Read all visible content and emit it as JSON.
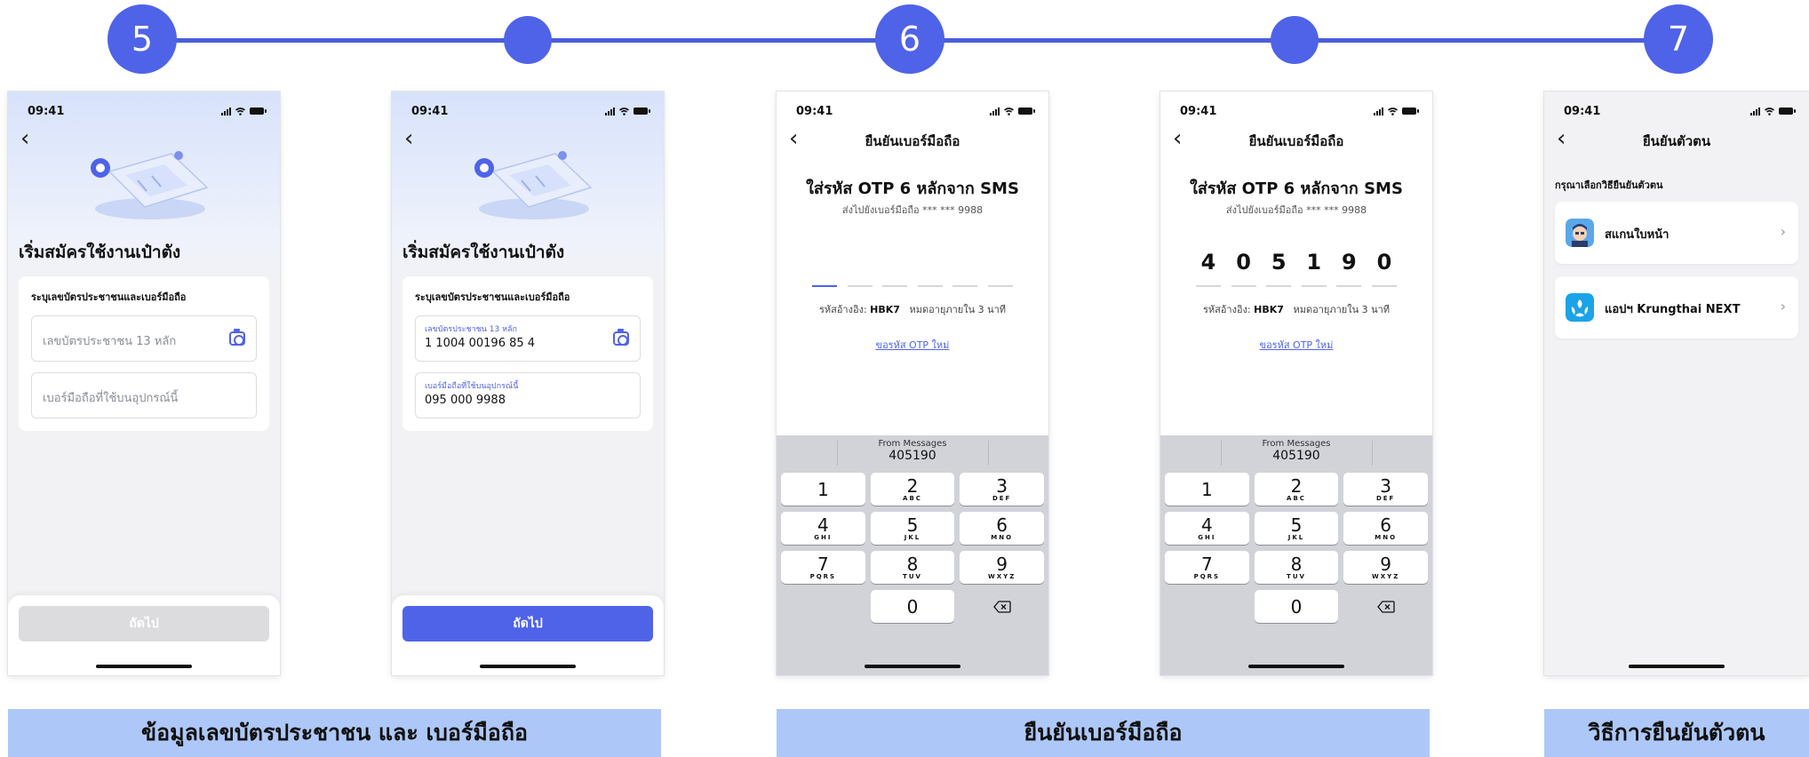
{
  "steps": [
    "5",
    "6",
    "7"
  ],
  "status_time": "09:41",
  "screen1": {
    "heading": "เริ่มสมัครใช้งานเป๋าตัง",
    "card_label": "ระบุเลขบัตรประชาชนและเบอร์มือถือ",
    "id_placeholder": "เลขบัตรประชาชน 13 หลัก",
    "phone_placeholder": "เบอร์มือถือที่ใช้บนอุปกรณ์นี้",
    "next_label": "ถัดไป"
  },
  "screen2": {
    "heading": "เริ่มสมัครใช้งานเป๋าตัง",
    "card_label": "ระบุเลขบัตรประชาชนและเบอร์มือถือ",
    "id_label": "เลขบัตรประชาชน 13 หลัก",
    "id_value": "1 1004 00196 85 4",
    "phone_label": "เบอร์มือถือที่ใช้บนอุปกรณ์นี้",
    "phone_value": "095 000 9988",
    "next_label": "ถัดไป"
  },
  "otp": {
    "nav_title": "ยืนยันเบอร์มือถือ",
    "title": "ใส่รหัส OTP 6 หลักจาก SMS",
    "subtitle": "ส่งไปยังเบอร์มือถือ *** *** 9988",
    "ref_prefix": "รหัสอ้างอิง:",
    "ref_code": "HBK7",
    "ref_expiry": "หมดอายุภายใน 3 นาที",
    "resend": "ขอรหัส OTP ใหม่",
    "digits": [
      "4",
      "0",
      "5",
      "1",
      "9",
      "0"
    ],
    "suggestion_source": "From Messages",
    "suggestion_code": "405190"
  },
  "keypad": [
    {
      "d": "1",
      "l": ""
    },
    {
      "d": "2",
      "l": "ABC"
    },
    {
      "d": "3",
      "l": "DEF"
    },
    {
      "d": "4",
      "l": "GHI"
    },
    {
      "d": "5",
      "l": "JKL"
    },
    {
      "d": "6",
      "l": "MNO"
    },
    {
      "d": "7",
      "l": "PQRS"
    },
    {
      "d": "8",
      "l": "TUV"
    },
    {
      "d": "9",
      "l": "WXYZ"
    },
    {
      "d": "",
      "l": ""
    },
    {
      "d": "0",
      "l": ""
    },
    {
      "d": "delete-icon",
      "l": ""
    }
  ],
  "verify": {
    "nav_title": "ยืนยันตัวตน",
    "label": "กรุณาเลือกวิธียืนยันตัวตน",
    "options": [
      {
        "label": "สแกนใบหน้า",
        "icon": "face-scan-icon"
      },
      {
        "label": "แอปฯ Krungthai NEXT",
        "icon": "krungthai-next-icon"
      }
    ]
  },
  "captions": [
    "ข้อมูลเลขบัตรประชาชน และ เบอร์มือถือ",
    "ยืนยันเบอร์มือถือ",
    "วิธีการยืนยันตัวตน"
  ],
  "colors": {
    "accent": "#4f63e8",
    "caption_bg": "#adc8f8",
    "disabled_btn": "#dcdcde"
  }
}
